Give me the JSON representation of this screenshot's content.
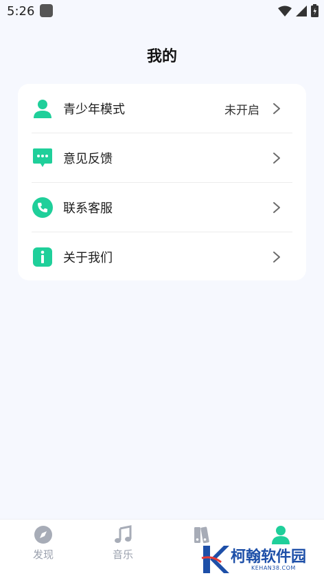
{
  "status": {
    "time": "5:26"
  },
  "title": "我的",
  "menu": [
    {
      "label": "青少年模式",
      "value": "未开启",
      "icon": "user-icon"
    },
    {
      "label": "意见反馈",
      "value": "",
      "icon": "chat-bubble-icon"
    },
    {
      "label": "联系客服",
      "value": "",
      "icon": "phone-icon"
    },
    {
      "label": "关于我们",
      "value": "",
      "icon": "info-icon"
    }
  ],
  "tabs": [
    {
      "label": "发现",
      "icon": "compass-icon",
      "active": false
    },
    {
      "label": "音乐",
      "icon": "music-note-icon",
      "active": false
    },
    {
      "label": "",
      "icon": "books-icon",
      "active": false
    },
    {
      "label": "",
      "icon": "user-icon",
      "active": true
    }
  ],
  "watermark": {
    "text": "柯翰软件园",
    "sub": "KEHAN38.COM"
  },
  "colors": {
    "accent": "#1fcf9a",
    "background": "#f6f8fe",
    "tab_inactive": "#9aa0ad"
  }
}
